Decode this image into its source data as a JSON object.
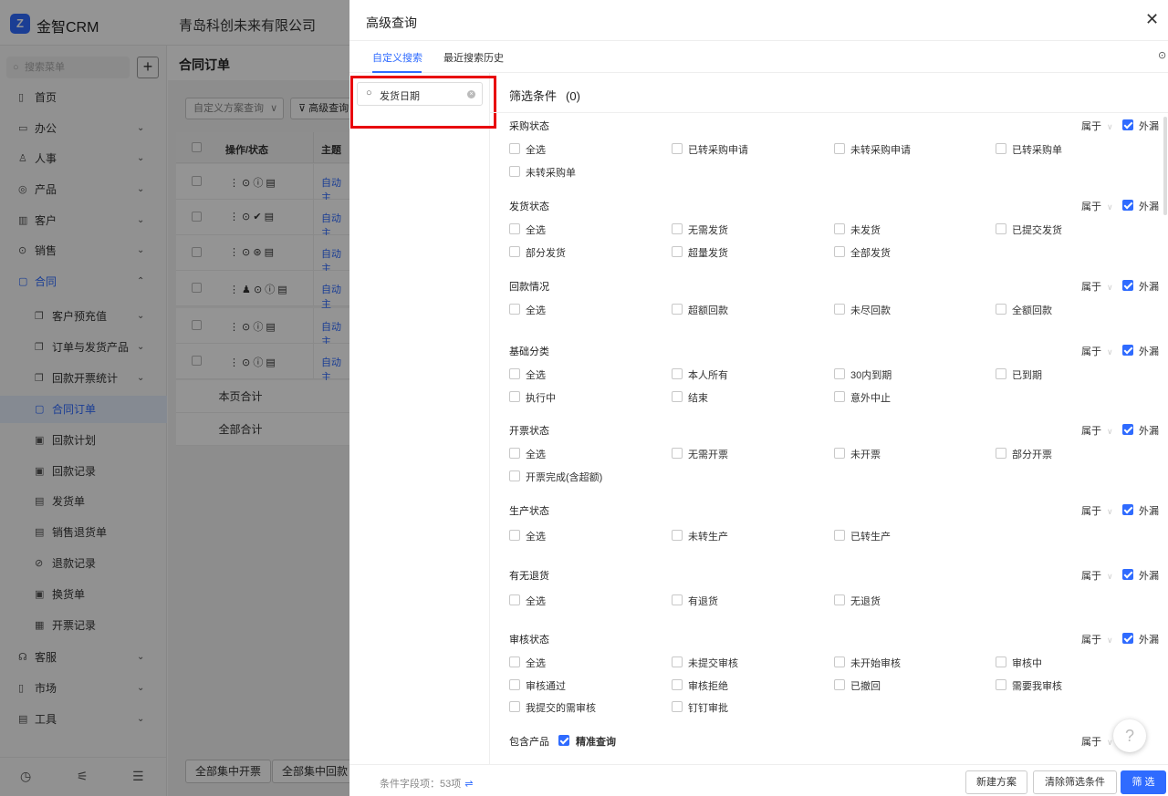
{
  "app": {
    "logo_glyph": "Z",
    "name": "金智CRM",
    "company": "青岛科创未来有限公司"
  },
  "sidebar": {
    "search_placeholder": "搜索菜单",
    "add_label": "+",
    "items": [
      {
        "icon": "home-icon",
        "glyph": "▯",
        "label": "首页"
      },
      {
        "icon": "briefcase-icon",
        "glyph": "▭",
        "label": "办公",
        "chevron": "⌄"
      },
      {
        "icon": "people-icon",
        "glyph": "♙",
        "label": "人事",
        "chevron": "⌄"
      },
      {
        "icon": "box-icon",
        "glyph": "◎",
        "label": "产品",
        "chevron": "⌄"
      },
      {
        "icon": "customer-icon",
        "glyph": "▥",
        "label": "客户",
        "chevron": "⌄"
      },
      {
        "icon": "sales-icon",
        "glyph": "⊙",
        "label": "销售",
        "chevron": "⌄"
      },
      {
        "icon": "contract-icon",
        "glyph": "▢",
        "label": "合同",
        "chevron": "⌃"
      }
    ],
    "sub_items": [
      {
        "icon": "copy-icon",
        "glyph": "❐",
        "label": "客户预充值",
        "chevron": "⌄"
      },
      {
        "icon": "copy-icon",
        "glyph": "❐",
        "label": "订单与发货产品",
        "chevron": "⌄"
      },
      {
        "icon": "copy-icon",
        "glyph": "❐",
        "label": "回款开票统计",
        "chevron": "⌄"
      },
      {
        "icon": "doc-icon",
        "glyph": "▢",
        "label": "合同订单"
      },
      {
        "icon": "plan-icon",
        "glyph": "▣",
        "label": "回款计划"
      },
      {
        "icon": "record-icon",
        "glyph": "▣",
        "label": "回款记录"
      },
      {
        "icon": "delivery-icon",
        "glyph": "▤",
        "label": "发货单"
      },
      {
        "icon": "return-icon",
        "glyph": "▤",
        "label": "销售退货单"
      },
      {
        "icon": "refund-icon",
        "glyph": "⊘",
        "label": "退款记录"
      },
      {
        "icon": "exchange-icon",
        "glyph": "▣",
        "label": "换货单"
      },
      {
        "icon": "invoice-icon",
        "glyph": "▦",
        "label": "开票记录"
      }
    ],
    "bottom_items": [
      {
        "icon": "headset-icon",
        "glyph": "☊",
        "label": "客服",
        "chevron": "⌄"
      },
      {
        "icon": "market-icon",
        "glyph": "▯",
        "label": "市场",
        "chevron": "⌄"
      },
      {
        "icon": "tools-icon",
        "glyph": "▤",
        "label": "工具",
        "chevron": "⌄"
      }
    ],
    "footer_icons": [
      {
        "icon": "history-icon",
        "glyph": "◷"
      },
      {
        "icon": "settings-sliders-icon",
        "glyph": "⚟"
      },
      {
        "icon": "collapse-icon",
        "glyph": "☰"
      }
    ]
  },
  "main": {
    "title": "合同订单",
    "scheme_select": "自定义方案查询",
    "scheme_chevron": "∨",
    "advanced_btn": "高级查询",
    "filter_icon_glyph": "⊽",
    "table_headers": {
      "status": "操作/状态",
      "subject": "主题"
    },
    "rows": [
      {
        "icons": "⋮ ⊙ ⓘ ▤",
        "subject": "自动主"
      },
      {
        "icons": "⋮ ⊙ ✔ ▤",
        "subject": "自动主"
      },
      {
        "icons": "⋮ ⊙ ⊛ ▤",
        "subject": "自动主"
      },
      {
        "icons": "⋮ ♟ ⊙ ⓘ ▤",
        "subject": "自动主"
      },
      {
        "icons": "⋮ ⊙ ⓘ ▤",
        "subject": "自动主"
      },
      {
        "icons": "⋮ ⊙ ⓘ ▤",
        "subject": "自动主"
      }
    ],
    "page_total": "本页合计",
    "all_total": "全部合计",
    "footer_buttons": [
      "全部集中开票",
      "全部集中回款"
    ]
  },
  "drawer": {
    "title": "高级查询",
    "close_glyph": "✕",
    "tabs": [
      "自定义搜索",
      "最近搜索历史"
    ],
    "tab_right_glyph": "⊙",
    "field_search_value": "发货日期",
    "field_search_clear": "×",
    "filter_title": "筛选条件",
    "filter_count": "(0)",
    "belong_label": "属于",
    "belong_chevron": "∨",
    "missing_label": "外漏",
    "sections": [
      {
        "title": "采购状态",
        "options": [
          "全选",
          "已转采购申请",
          "未转采购申请",
          "已转采购单",
          "未转采购单"
        ]
      },
      {
        "title": "发货状态",
        "options": [
          "全选",
          "无需发货",
          "未发货",
          "已提交发货",
          "部分发货",
          "超量发货",
          "全部发货"
        ]
      },
      {
        "title": "回款情况",
        "options": [
          "全选",
          "超额回款",
          "未尽回款",
          "全额回款"
        ]
      },
      {
        "title": "基础分类",
        "options": [
          "全选",
          "本人所有",
          "30内到期",
          "已到期",
          "执行中",
          "结束",
          "意外中止"
        ]
      },
      {
        "title": "开票状态",
        "options": [
          "全选",
          "无需开票",
          "未开票",
          "部分开票",
          "开票完成(含超额)"
        ]
      },
      {
        "title": "生产状态",
        "options": [
          "全选",
          "未转生产",
          "已转生产"
        ]
      },
      {
        "title": "有无退货",
        "options": [
          "全选",
          "有退货",
          "无退货"
        ]
      },
      {
        "title": "审核状态",
        "options": [
          "全选",
          "未提交审核",
          "未开始审核",
          "审核中",
          "审核通过",
          "审核拒绝",
          "已撤回",
          "需要我审核",
          "我提交的需审核",
          "钉钉审批"
        ]
      }
    ],
    "product_title": "包含产品",
    "exact_query": "精准查询",
    "footer": {
      "condition_count": "条件字段项：53项",
      "condition_icon_glyph": "⇌",
      "new_scheme": "新建方案",
      "clear_conditions": "清除筛选条件",
      "filter": "筛 选"
    },
    "help_glyph": "?"
  }
}
